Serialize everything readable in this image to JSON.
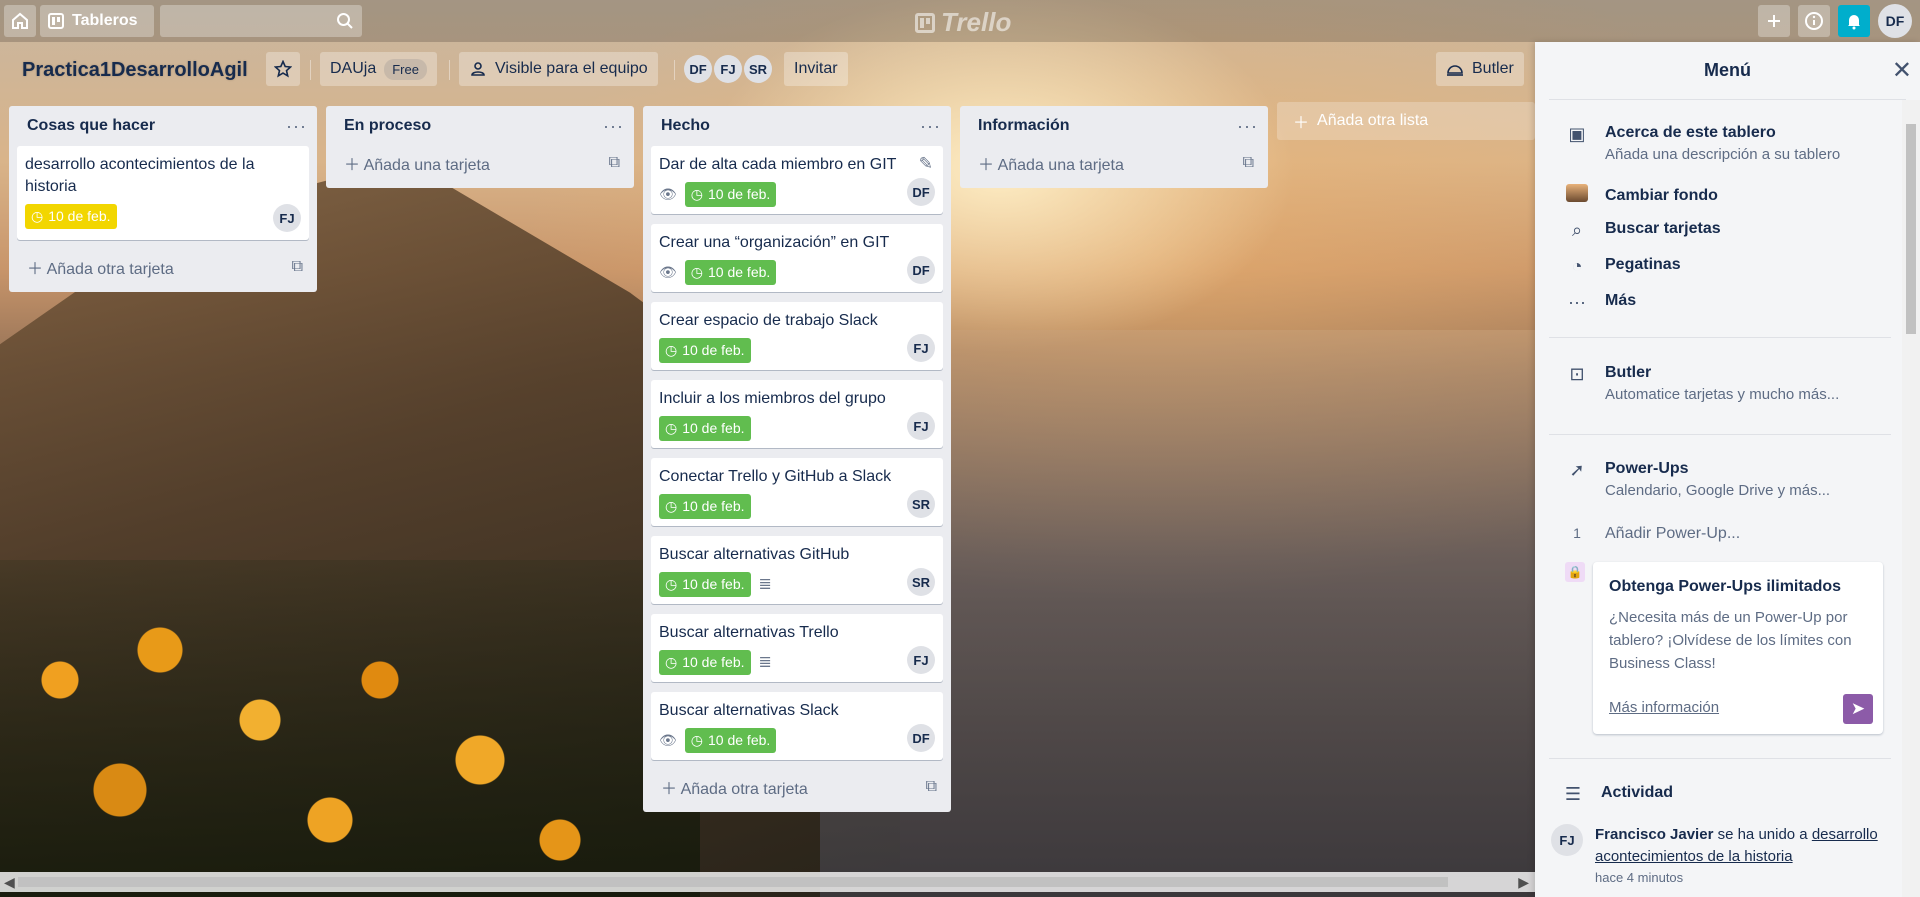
{
  "header": {
    "boards_label": "Tableros",
    "logo_text": "Trello",
    "user_initials": "DF"
  },
  "board": {
    "title": "Practica1DesarrolloAgil",
    "team_name": "DAUja",
    "team_plan": "Free",
    "visibility": "Visible para el equipo",
    "members": [
      "DF",
      "FJ",
      "SR"
    ],
    "invite_label": "Invitar",
    "butler_label": "Butler",
    "add_list_label": "Añada otra lista"
  },
  "lists": [
    {
      "title": "Cosas que hacer",
      "cards": [
        {
          "title": "desarrollo acontecimientos de la historia",
          "due": "10 de feb.",
          "member": "FJ"
        }
      ],
      "add_label": "Añada otra tarjeta"
    },
    {
      "title": "En proceso",
      "cards": [],
      "add_label": "Añada una tarjeta"
    },
    {
      "title": "Hecho",
      "cards": [
        {
          "title": "Dar de alta cada miembro en GIT",
          "due": "10 de feb.",
          "member": "DF"
        },
        {
          "title": "Crear una “organización” en GIT",
          "due": "10 de feb.",
          "member": "DF"
        },
        {
          "title": "Crear espacio de trabajo Slack",
          "due": "10 de feb.",
          "member": "FJ"
        },
        {
          "title": "Incluir a los miembros del grupo",
          "due": "10 de feb.",
          "member": "FJ"
        },
        {
          "title": "Conectar Trello y GitHub a Slack",
          "due": "10 de feb.",
          "member": "SR"
        },
        {
          "title": "Buscar alternativas GitHub",
          "due": "10 de feb.",
          "member": "SR"
        },
        {
          "title": "Buscar alternativas Trello",
          "due": "10 de feb.",
          "member": "FJ"
        },
        {
          "title": "Buscar alternativas Slack",
          "due": "10 de feb.",
          "member": "DF"
        }
      ],
      "add_label": "Añada otra tarjeta"
    },
    {
      "title": "Información",
      "cards": [],
      "add_label": "Añada una tarjeta"
    }
  ],
  "menu": {
    "title": "Menú",
    "about_title": "Acerca de este tablero",
    "about_sub": "Añada una descripción a su tablero",
    "change_bg": "Cambiar fondo",
    "search_cards": "Buscar tarjetas",
    "stickers": "Pegatinas",
    "more": "Más",
    "butler_title": "Butler",
    "butler_sub": "Automatice tarjetas y mucho más...",
    "powerups_title": "Power-Ups",
    "powerups_sub": "Calendario, Google Drive y más...",
    "powerups_count": "1",
    "add_powerup": "Añadir Power-Up...",
    "promo_title": "Obtenga Power-Ups ilimitados",
    "promo_text": "¿Necesita más de un Power-Up por tablero? ¡Olvídese de los límites con Business Class!",
    "promo_link": "Más información",
    "activity_title": "Actividad",
    "activity_avatar": "FJ",
    "activity_user": "Francisco Javier",
    "activity_action": "se ha unido a",
    "activity_target": "desarrollo acontecimientos de la historia",
    "activity_time": "hace 4 minutos"
  }
}
